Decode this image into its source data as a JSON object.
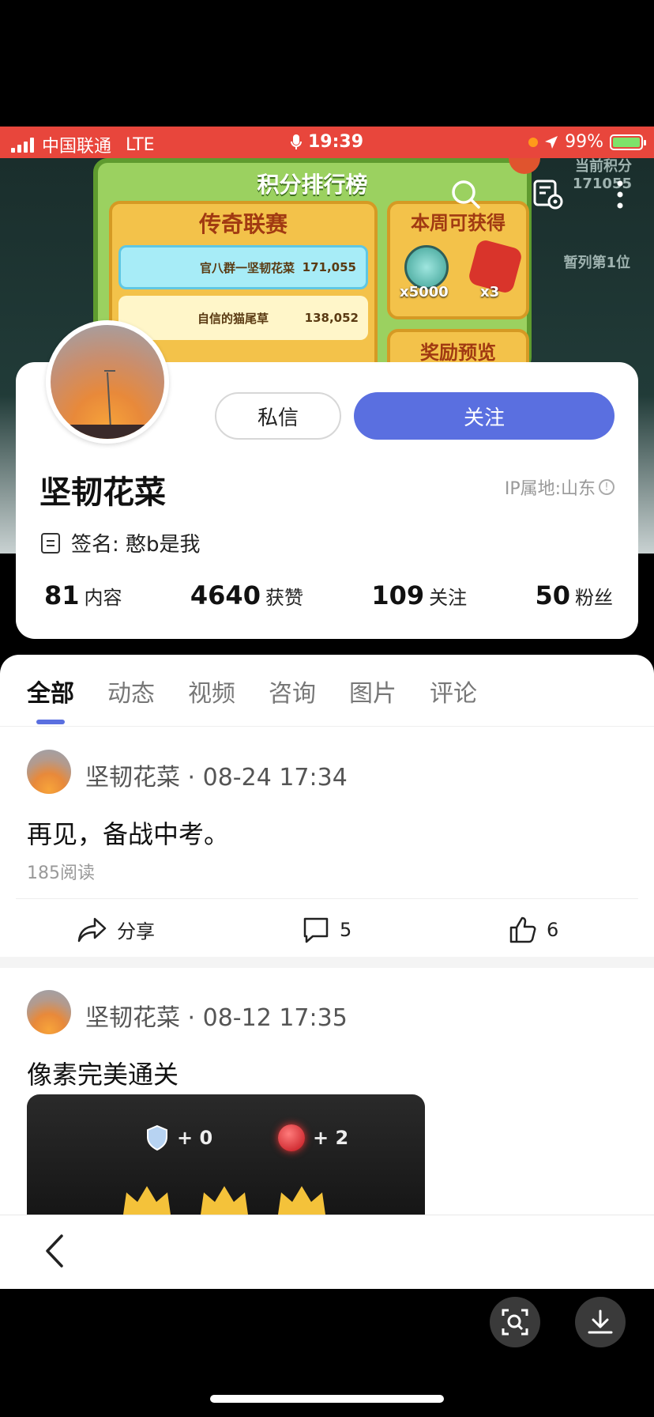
{
  "status_bar": {
    "carrier": "中国联通",
    "network": "LTE",
    "time": "19:39",
    "battery": "99%"
  },
  "banner": {
    "title": "积分排行榜",
    "league": "传奇联赛",
    "rows": [
      {
        "name": "官八群一坚韧花菜",
        "score": "171,055"
      },
      {
        "name": "自信的猫尾草",
        "score": "138,052"
      }
    ],
    "weekly_title": "本周可获得",
    "reward_1": "x5000",
    "reward_2": "x3",
    "preview_title": "奖励预览",
    "score_label": "当前积分",
    "score_value": "171055",
    "rank_text": "暂列第1位"
  },
  "profile": {
    "message_button": "私信",
    "follow_button": "关注",
    "username": "坚韧花菜",
    "ip_location": "IP属地:山东",
    "signature": "签名:  憨b是我",
    "stats": [
      {
        "num": "81",
        "label": "内容"
      },
      {
        "num": "4640",
        "label": "获赞"
      },
      {
        "num": "109",
        "label": "关注"
      },
      {
        "num": "50",
        "label": "粉丝"
      }
    ]
  },
  "tabs": [
    "全部",
    "动态",
    "视频",
    "咨询",
    "图片",
    "评论"
  ],
  "posts": [
    {
      "author": "坚韧花菜",
      "time": "· 08-24 17:34",
      "text": "再见，备战中考。",
      "reads": "185阅读",
      "share_label": "分享",
      "comments": "5",
      "likes": "6"
    },
    {
      "author": "坚韧花菜",
      "time": "· 08-12 17:35",
      "text": "像素完美通关",
      "image_stat_1": "+ 0",
      "image_stat_2": "+ 2"
    }
  ],
  "icons": {
    "search": "search-icon",
    "screenshot_settings": "screenshot-settings-icon",
    "more": "more-vert-icon",
    "back": "chevron-left-icon",
    "scan": "scan-icon",
    "download": "download-icon"
  },
  "colors": {
    "accent": "#5a6fe0",
    "status_bar": "#e8463c"
  }
}
